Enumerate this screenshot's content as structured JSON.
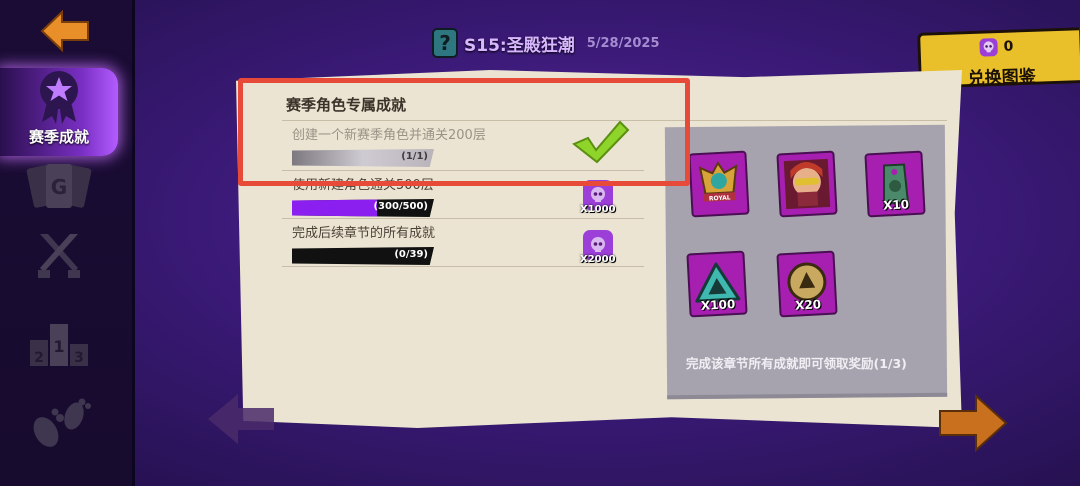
{
  "header": {
    "season_badge": "?",
    "season_title": "S15:圣殿狂潮",
    "date": "5/28/2025"
  },
  "exchange": {
    "count": "0",
    "label": "兑换图鉴"
  },
  "sidebar": {
    "items": [
      {
        "label": "赛季成就",
        "icon": "ribbon-star-icon",
        "active": true
      },
      {
        "label": "",
        "icon": "cards-icon",
        "active": false
      },
      {
        "label": "",
        "icon": "crossed-swords-icon",
        "active": false
      },
      {
        "label": "",
        "icon": "podium-icon",
        "active": false
      },
      {
        "label": "",
        "icon": "footprints-icon",
        "active": false
      }
    ],
    "podium_digits": [
      "2",
      "1",
      "3"
    ]
  },
  "achievements": {
    "section_title": "赛季角色专属成就",
    "items": [
      {
        "text": "创建一个新赛季角色并通关200层",
        "progress": "(1/1)",
        "fraction": 1.0,
        "completed": true,
        "reward": ""
      },
      {
        "text": "使用新建角色通关500层",
        "progress": "(300/500)",
        "fraction": 0.6,
        "completed": false,
        "reward": "X1000"
      },
      {
        "text": "完成后续章节的所有成就",
        "progress": "(0/39)",
        "fraction": 0.0,
        "completed": false,
        "reward": "X2000"
      }
    ]
  },
  "rewards_board": {
    "tiles": [
      {
        "icon": "royal-emblem-icon",
        "amount": "",
        "sublabel": "ROYAL"
      },
      {
        "icon": "hero-portrait-icon",
        "amount": ""
      },
      {
        "icon": "tag-icon",
        "amount": "X10"
      },
      {
        "icon": "triangle-rune-icon",
        "amount": "X100"
      },
      {
        "icon": "gold-rune-icon",
        "amount": "X20"
      }
    ],
    "note": "完成该章节所有成就即可领取奖励(1/3)"
  },
  "colors": {
    "accent_purple": "#7a2fc4",
    "progress_purple": "#8a1ff0",
    "highlight_red": "#e84a3a",
    "check_green": "#8fd42a",
    "exchange_yellow": "#e9bf2a",
    "tile_magenta": "#a61fb0"
  }
}
